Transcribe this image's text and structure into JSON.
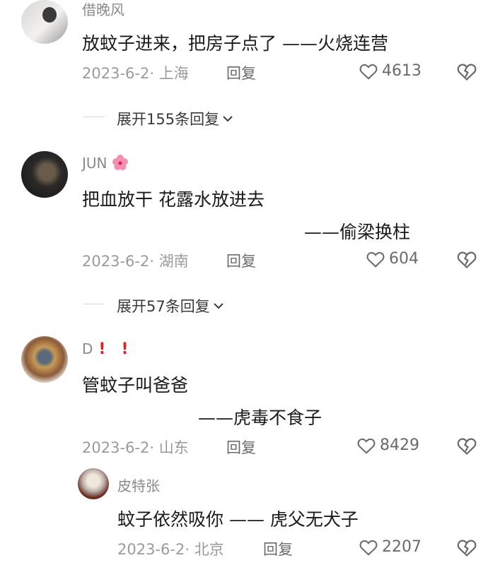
{
  "comments": [
    {
      "username": "借晚风",
      "text": "放蚊子进来，把房子点了 ——火烧连营",
      "date": "2023-6-2",
      "location": "上海",
      "reply_label": "回复",
      "likes": "4613",
      "expand_label": "展开155条回复"
    },
    {
      "username": "JUN",
      "text_line1": "把血放干  花露水放进去",
      "text_line2": "——偷梁换柱",
      "date": "2023-6-2",
      "location": "湖南",
      "reply_label": "回复",
      "likes": "604",
      "expand_label": "展开57条回复"
    },
    {
      "username": "D",
      "text_line1": "管蚊子叫爸爸",
      "text_line2": "——虎毒不食子",
      "date": "2023-6-2",
      "location": "山东",
      "reply_label": "回复",
      "likes": "8429"
    }
  ],
  "reply": {
    "username": "皮特张",
    "text": "蚊子依然吸你 —— 虎父无犬子",
    "date": "2023-6-2",
    "location": "北京",
    "reply_label": "回复",
    "likes": "2207"
  },
  "colors": {
    "excl": "#e02020",
    "flower": "#f48fb1"
  },
  "icons": [
    "heart-outline-icon",
    "broken-heart-icon",
    "chevron-down-icon",
    "cherry-blossom-emoji",
    "exclamation-emoji"
  ]
}
